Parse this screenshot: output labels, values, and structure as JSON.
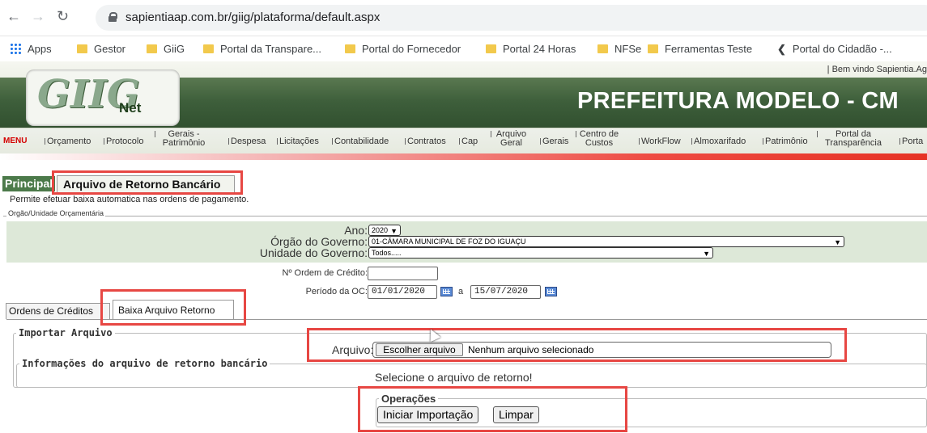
{
  "browser": {
    "url": "sapientiaap.com.br/giig/plataforma/default.aspx",
    "bookmarks": [
      "Apps",
      "Gestor",
      "GiiG",
      "Portal da Transpare...",
      "Portal do Fornecedor",
      "Portal 24 Horas",
      "NFSe",
      "Ferramentas Teste",
      "Portal do Cidadão -..."
    ]
  },
  "header": {
    "welcome": "| Bem vindo Sapientia.Ag",
    "logo_main": "GIIG",
    "logo_sub": "Net",
    "title": "PREFEITURA MODELO - CM"
  },
  "menu": {
    "label": "MENU",
    "items": [
      "Orçamento",
      "Protocolo",
      "Gerais - Patrimônio",
      "Despesa",
      "Licitações",
      "Contabilidade",
      "Contratos",
      "Cap",
      "Arquivo Geral",
      "Gerais",
      "Centro de Custos",
      "WorkFlow",
      "Almoxarifado",
      "Patrimônio",
      "Portal da Transparência",
      "Porta"
    ]
  },
  "tabs": {
    "principal": "Principal",
    "active": "Arquivo de Retorno Bancário"
  },
  "description": "Permite efetuar baixa automatica nas ordens de pagamento.",
  "section": "Orgão/Unidade Orçamentária",
  "form": {
    "ano_label": "Ano:",
    "ano_value": "2020",
    "orgao_label": "Órgão do Governo:",
    "orgao_value": "01-CÂMARA MUNICIPAL DE FOZ DO IGUAÇU",
    "unidade_label": "Unidade do Governo:",
    "unidade_value": "Todos.....",
    "ordem_label": "Nº Ordem de Crédito:",
    "ordem_value": "",
    "periodo_label": "Período da OC:",
    "periodo_start": "01/01/2020",
    "periodo_sep": "a",
    "periodo_end": "15/07/2020"
  },
  "subtabs": {
    "tab1": "Ordens de Créditos",
    "tab2": "Baixa Arquivo Retorno"
  },
  "importar": {
    "legend": "Importar Arquivo",
    "label": "Arquivo:",
    "button": "Escolher arquivo",
    "status": "Nenhum arquivo selecionado"
  },
  "info": {
    "legend": "Informações do arquivo de retorno bancário",
    "message": "Selecione o arquivo de retorno!"
  },
  "operacoes": {
    "legend": "Operações",
    "start": "Iniciar Importação",
    "clear": "Limpar"
  },
  "colors": {
    "header_green": "#3e5f3b",
    "accent_red": "#e74743",
    "form_green": "#dde8d8"
  }
}
